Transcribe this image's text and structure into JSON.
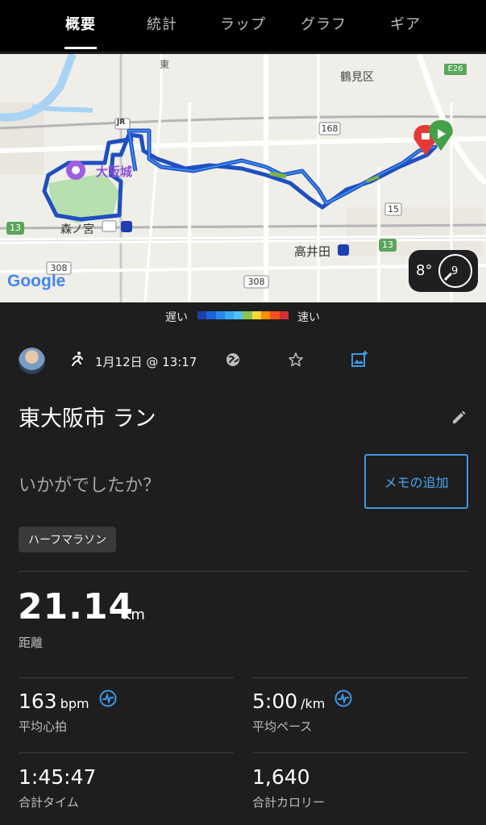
{
  "tabs": [
    {
      "label": "概要",
      "active": true
    },
    {
      "label": "統計",
      "active": false
    },
    {
      "label": "ラップ",
      "active": false
    },
    {
      "label": "グラフ",
      "active": false
    },
    {
      "label": "ギア",
      "active": false
    }
  ],
  "map": {
    "labels": {
      "tsurumi": "鶴見区",
      "osakajo": "大阪城",
      "morinomiya": "森ノ宮",
      "takaida": "高井田",
      "higashi": "東",
      "jr": "JR"
    },
    "route_numbers": [
      "168",
      "15",
      "13",
      "13",
      "308",
      "308",
      "E26"
    ],
    "google_logo": "Google",
    "temperature": "8°",
    "wind": "9"
  },
  "legend": {
    "slow": "遅い",
    "fast": "速い",
    "colors": [
      "#1e3fb0",
      "#1c62d8",
      "#2a86ee",
      "#38a9f5",
      "#4fc3f7",
      "#8bc34a",
      "#fdd835",
      "#fb8c00",
      "#f4511e",
      "#d32f2f"
    ]
  },
  "activity": {
    "datetime": "1月12日 @ 13:17",
    "title": "東大阪市 ラン",
    "memo_prompt": "いかがでしたか？",
    "memo_button": "メモの追加",
    "tag": "ハーフマラソン"
  },
  "stats": {
    "distance": {
      "value": "21.14",
      "unit": "km",
      "label": "距離"
    },
    "heart_rate": {
      "value": "163",
      "unit": "bpm",
      "label": "平均心拍"
    },
    "pace": {
      "value": "5:00",
      "unit": "/km",
      "label": "平均ペース"
    },
    "time": {
      "value": "1:45:47",
      "label": "合計タイム"
    },
    "calories": {
      "value": "1,640",
      "label": "合計カロリー"
    }
  },
  "colors": {
    "accent": "#3d98e6",
    "background": "#1e1e1e",
    "route": "#1f5fc4"
  }
}
